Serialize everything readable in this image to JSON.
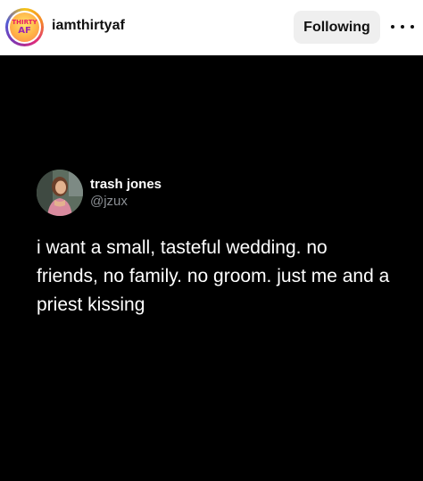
{
  "post_header": {
    "avatar_text_line1": "THIRTY",
    "avatar_text_line2": "AF",
    "username": "iamthirtyaf",
    "follow_button_label": "Following",
    "more_icon": "more-horizontal-icon"
  },
  "tweet": {
    "display_name": "trash jones",
    "handle": "@jzux",
    "text": "i want a small, tasteful wedding. no friends, no family. no groom. just me and a priest kissing"
  },
  "colors": {
    "header_bg": "#ffffff",
    "tweet_bg": "#000000",
    "handle_gray": "#8b8f94",
    "button_bg": "#efefef"
  }
}
